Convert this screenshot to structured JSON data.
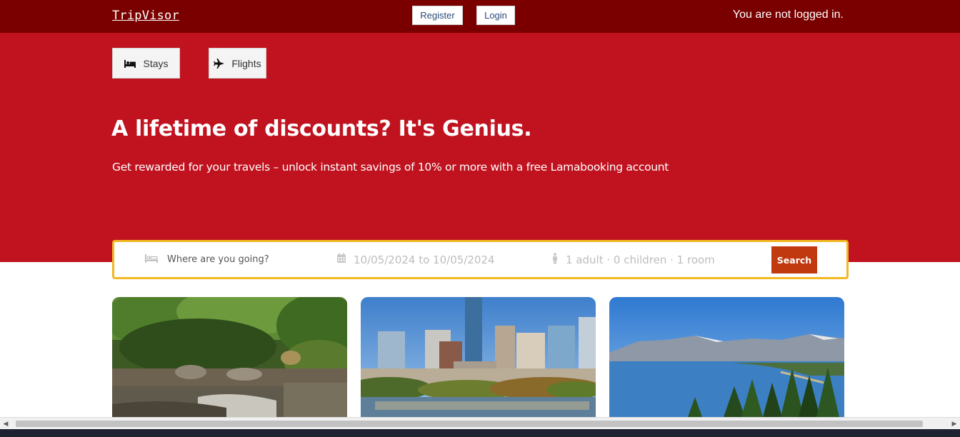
{
  "navbar": {
    "logo": "TripVisor",
    "register_label": "Register",
    "login_label": "Login",
    "login_status": "You are not logged in."
  },
  "hero": {
    "tabs": [
      {
        "label": "Stays",
        "icon": "bed-icon"
      },
      {
        "label": "Flights",
        "icon": "plane-icon"
      }
    ],
    "title": "A lifetime of discounts? It's Genius.",
    "subtitle": "Get rewarded for your travels – unlock instant savings of 10% or more with a free Lamabooking account"
  },
  "search": {
    "destination_placeholder": "Where are you going?",
    "date_range": "10/05/2024 to 10/05/2024",
    "guests": "1 adult · 0 children · 1 room",
    "button_label": "Search"
  },
  "colors": {
    "navbar": "#7a0000",
    "hero": "#c0121f",
    "search_border": "#f2b721",
    "search_button": "#c0390f"
  }
}
